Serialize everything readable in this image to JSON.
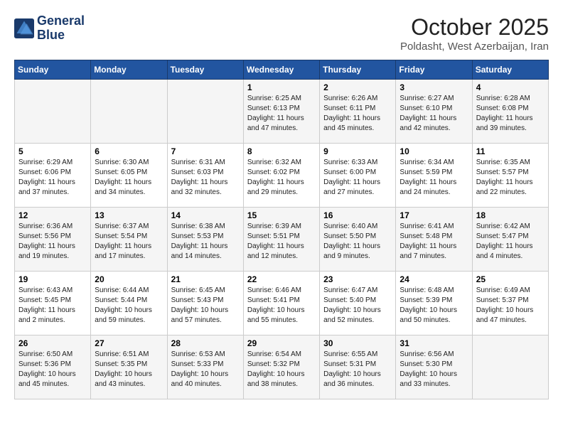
{
  "header": {
    "logo_line1": "General",
    "logo_line2": "Blue",
    "title": "October 2025",
    "subtitle": "Poldasht, West Azerbaijan, Iran"
  },
  "columns": [
    "Sunday",
    "Monday",
    "Tuesday",
    "Wednesday",
    "Thursday",
    "Friday",
    "Saturday"
  ],
  "weeks": [
    [
      {
        "day": "",
        "info": ""
      },
      {
        "day": "",
        "info": ""
      },
      {
        "day": "",
        "info": ""
      },
      {
        "day": "1",
        "info": "Sunrise: 6:25 AM\nSunset: 6:13 PM\nDaylight: 11 hours\nand 47 minutes."
      },
      {
        "day": "2",
        "info": "Sunrise: 6:26 AM\nSunset: 6:11 PM\nDaylight: 11 hours\nand 45 minutes."
      },
      {
        "day": "3",
        "info": "Sunrise: 6:27 AM\nSunset: 6:10 PM\nDaylight: 11 hours\nand 42 minutes."
      },
      {
        "day": "4",
        "info": "Sunrise: 6:28 AM\nSunset: 6:08 PM\nDaylight: 11 hours\nand 39 minutes."
      }
    ],
    [
      {
        "day": "5",
        "info": "Sunrise: 6:29 AM\nSunset: 6:06 PM\nDaylight: 11 hours\nand 37 minutes."
      },
      {
        "day": "6",
        "info": "Sunrise: 6:30 AM\nSunset: 6:05 PM\nDaylight: 11 hours\nand 34 minutes."
      },
      {
        "day": "7",
        "info": "Sunrise: 6:31 AM\nSunset: 6:03 PM\nDaylight: 11 hours\nand 32 minutes."
      },
      {
        "day": "8",
        "info": "Sunrise: 6:32 AM\nSunset: 6:02 PM\nDaylight: 11 hours\nand 29 minutes."
      },
      {
        "day": "9",
        "info": "Sunrise: 6:33 AM\nSunset: 6:00 PM\nDaylight: 11 hours\nand 27 minutes."
      },
      {
        "day": "10",
        "info": "Sunrise: 6:34 AM\nSunset: 5:59 PM\nDaylight: 11 hours\nand 24 minutes."
      },
      {
        "day": "11",
        "info": "Sunrise: 6:35 AM\nSunset: 5:57 PM\nDaylight: 11 hours\nand 22 minutes."
      }
    ],
    [
      {
        "day": "12",
        "info": "Sunrise: 6:36 AM\nSunset: 5:56 PM\nDaylight: 11 hours\nand 19 minutes."
      },
      {
        "day": "13",
        "info": "Sunrise: 6:37 AM\nSunset: 5:54 PM\nDaylight: 11 hours\nand 17 minutes."
      },
      {
        "day": "14",
        "info": "Sunrise: 6:38 AM\nSunset: 5:53 PM\nDaylight: 11 hours\nand 14 minutes."
      },
      {
        "day": "15",
        "info": "Sunrise: 6:39 AM\nSunset: 5:51 PM\nDaylight: 11 hours\nand 12 minutes."
      },
      {
        "day": "16",
        "info": "Sunrise: 6:40 AM\nSunset: 5:50 PM\nDaylight: 11 hours\nand 9 minutes."
      },
      {
        "day": "17",
        "info": "Sunrise: 6:41 AM\nSunset: 5:48 PM\nDaylight: 11 hours\nand 7 minutes."
      },
      {
        "day": "18",
        "info": "Sunrise: 6:42 AM\nSunset: 5:47 PM\nDaylight: 11 hours\nand 4 minutes."
      }
    ],
    [
      {
        "day": "19",
        "info": "Sunrise: 6:43 AM\nSunset: 5:45 PM\nDaylight: 11 hours\nand 2 minutes."
      },
      {
        "day": "20",
        "info": "Sunrise: 6:44 AM\nSunset: 5:44 PM\nDaylight: 10 hours\nand 59 minutes."
      },
      {
        "day": "21",
        "info": "Sunrise: 6:45 AM\nSunset: 5:43 PM\nDaylight: 10 hours\nand 57 minutes."
      },
      {
        "day": "22",
        "info": "Sunrise: 6:46 AM\nSunset: 5:41 PM\nDaylight: 10 hours\nand 55 minutes."
      },
      {
        "day": "23",
        "info": "Sunrise: 6:47 AM\nSunset: 5:40 PM\nDaylight: 10 hours\nand 52 minutes."
      },
      {
        "day": "24",
        "info": "Sunrise: 6:48 AM\nSunset: 5:39 PM\nDaylight: 10 hours\nand 50 minutes."
      },
      {
        "day": "25",
        "info": "Sunrise: 6:49 AM\nSunset: 5:37 PM\nDaylight: 10 hours\nand 47 minutes."
      }
    ],
    [
      {
        "day": "26",
        "info": "Sunrise: 6:50 AM\nSunset: 5:36 PM\nDaylight: 10 hours\nand 45 minutes."
      },
      {
        "day": "27",
        "info": "Sunrise: 6:51 AM\nSunset: 5:35 PM\nDaylight: 10 hours\nand 43 minutes."
      },
      {
        "day": "28",
        "info": "Sunrise: 6:53 AM\nSunset: 5:33 PM\nDaylight: 10 hours\nand 40 minutes."
      },
      {
        "day": "29",
        "info": "Sunrise: 6:54 AM\nSunset: 5:32 PM\nDaylight: 10 hours\nand 38 minutes."
      },
      {
        "day": "30",
        "info": "Sunrise: 6:55 AM\nSunset: 5:31 PM\nDaylight: 10 hours\nand 36 minutes."
      },
      {
        "day": "31",
        "info": "Sunrise: 6:56 AM\nSunset: 5:30 PM\nDaylight: 10 hours\nand 33 minutes."
      },
      {
        "day": "",
        "info": ""
      }
    ]
  ]
}
